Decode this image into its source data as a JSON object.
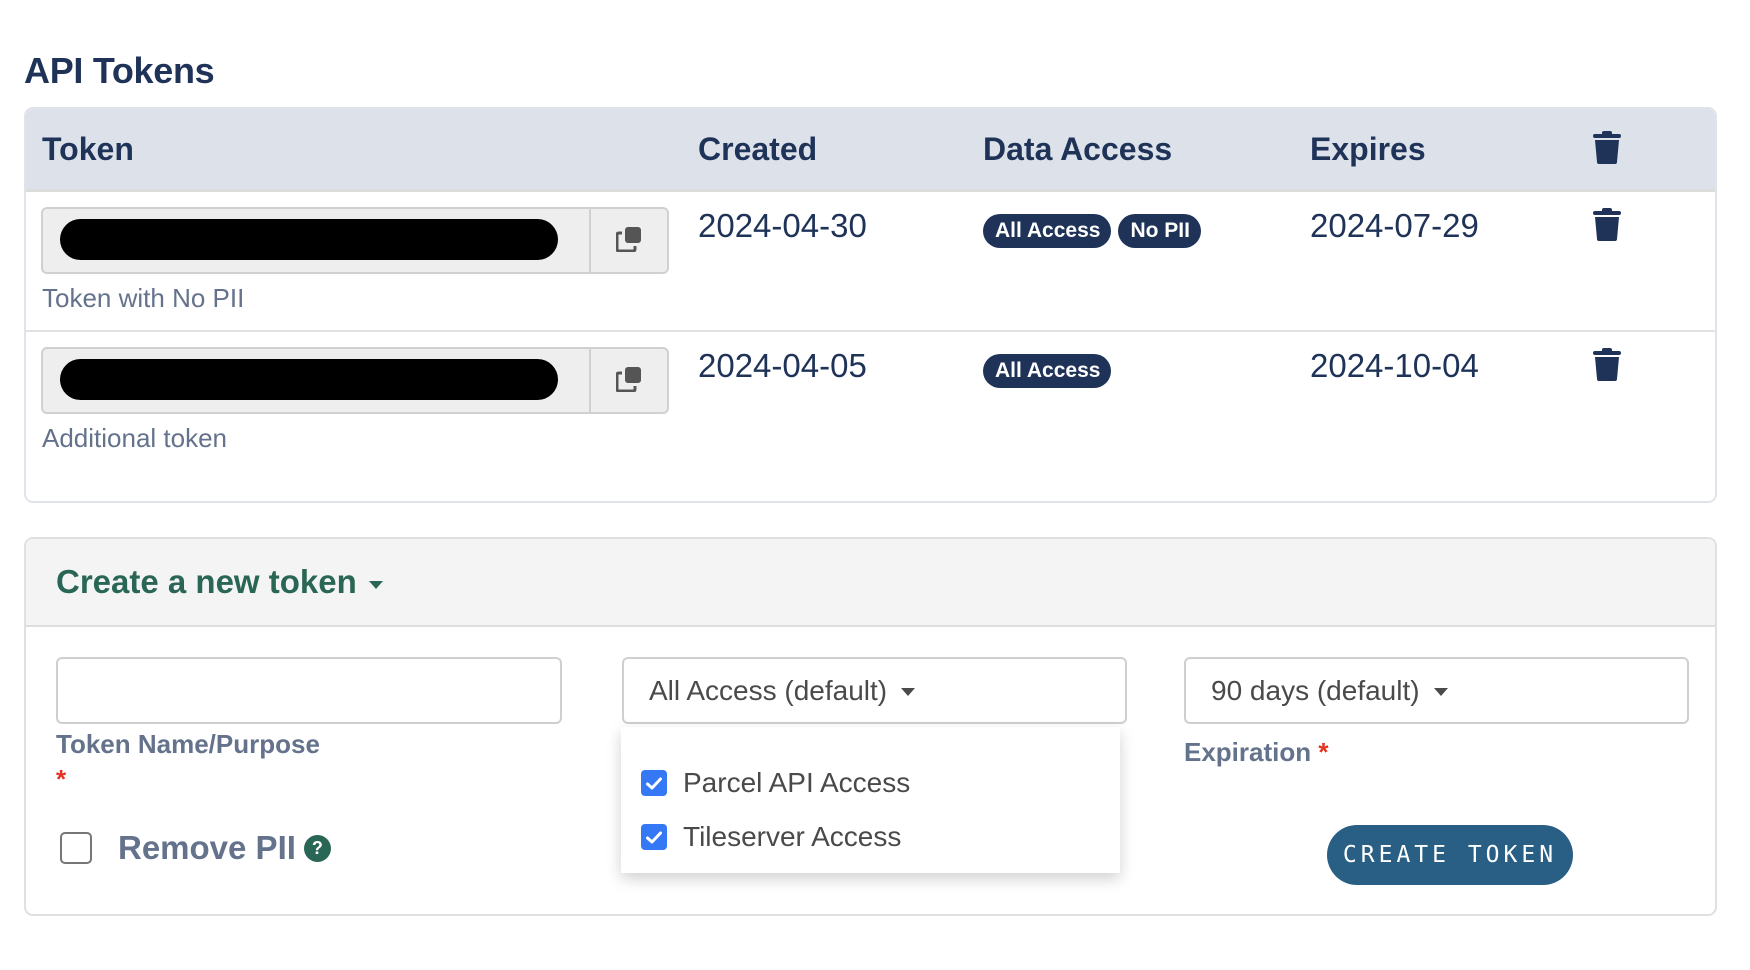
{
  "page": {
    "title": "API Tokens"
  },
  "colors": {
    "primary": "#1f3358",
    "header_bg": "#dde2ea",
    "create_accent": "#2a6655",
    "button_bg": "#2a5f85",
    "checkbox": "#3478f6",
    "required": "#e53322",
    "muted_label": "#64728c"
  },
  "tokens_table": {
    "columns": {
      "token": "Token",
      "created": "Created",
      "data_access": "Data Access",
      "expires": "Expires",
      "delete_icon": "trash-icon"
    },
    "rows": [
      {
        "token_value": "[redacted]",
        "name": "Token with No PII",
        "created": "2024-04-30",
        "badges": [
          "All Access",
          "No PII"
        ],
        "expires": "2024-07-29"
      },
      {
        "token_value": "[redacted]",
        "name": "Additional token",
        "created": "2024-04-05",
        "badges": [
          "All Access"
        ],
        "expires": "2024-10-04"
      }
    ]
  },
  "create_token": {
    "title": "Create a new token",
    "name_field": {
      "value": "",
      "placeholder": "",
      "label": "Token Name/Purpose",
      "required_mark": "*"
    },
    "access_select": {
      "selected": "All Access (default)"
    },
    "access_menu": {
      "items": [
        {
          "label": "Parcel API Access",
          "checked": true
        },
        {
          "label": "Tileserver Access",
          "checked": true
        }
      ]
    },
    "expiration_select": {
      "selected": "90 days (default)",
      "label": "Expiration",
      "required_mark": "*"
    },
    "remove_pii": {
      "label": "Remove PII",
      "checked": false,
      "help_icon": "?"
    },
    "submit_label": "CREATE TOKEN"
  }
}
